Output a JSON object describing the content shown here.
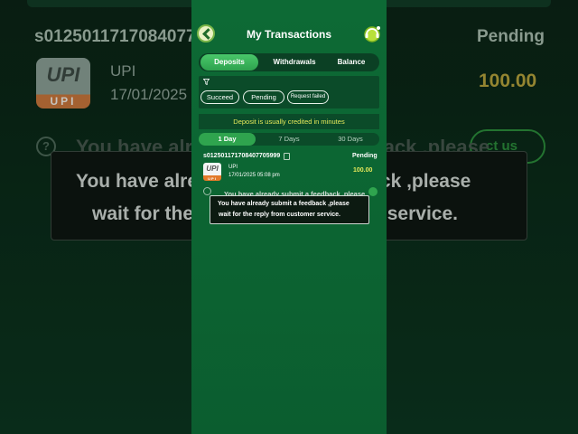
{
  "background": {
    "txid": "s0125011717084077",
    "status": "Pending",
    "method": "UPI",
    "date": "17/01/2025",
    "amount": "100.00",
    "logo_text": "UPI",
    "logo_caption": "UPI",
    "contact_label": "ct us",
    "ghost_text": "You have already submit a feedback ,please",
    "toast_line1": "You have already submit a feedback ,please",
    "toast_line2": "wait for the reply from customer service."
  },
  "header": {
    "title": "My Transactions"
  },
  "tabs": [
    {
      "label": "Deposits",
      "active": true
    },
    {
      "label": "Withdrawals",
      "active": false
    },
    {
      "label": "Balance",
      "active": false
    }
  ],
  "filters": {
    "chips": [
      "Succeed",
      "Pending",
      "Request failed"
    ]
  },
  "notice": "Deposit is usually credited in minutes",
  "ranges": [
    {
      "label": "1 Day",
      "active": true
    },
    {
      "label": "7 Days",
      "active": false
    },
    {
      "label": "30 Days",
      "active": false
    }
  ],
  "transaction": {
    "txid": "s012501171708407705999",
    "status": "Pending",
    "logo_text": "UPI",
    "logo_caption": "UPI",
    "method": "UPI",
    "date": "17/01/2025 05:08 pm",
    "amount": "100.00"
  },
  "toast": {
    "line1_ghost": "You have already submit a feedback ,please",
    "line1": "You have already submit a feedback ,please",
    "line2": "wait for the reply from customer service."
  },
  "colors": {
    "panel_green": "#0d6a35",
    "active_tab": "#2fa44e",
    "amount_yellow": "#e5e85a"
  }
}
